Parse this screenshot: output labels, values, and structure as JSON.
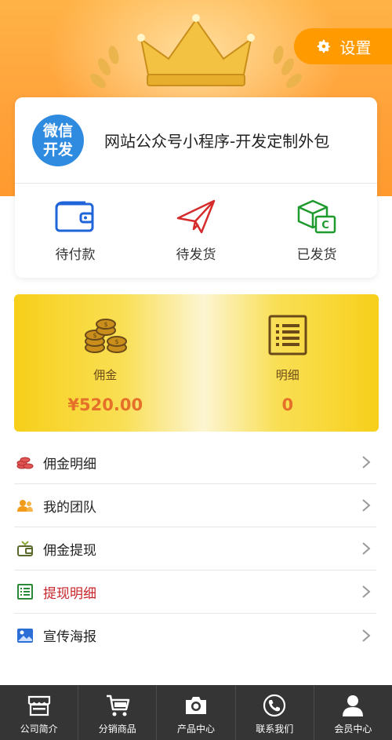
{
  "header": {
    "settings_label": "设置",
    "settings_icon": "gear-icon"
  },
  "profile": {
    "avatar_line1": "微信",
    "avatar_line2": "开发",
    "name": "网站公众号小程序-开发定制外包"
  },
  "orders": [
    {
      "label": "待付款",
      "icon": "wallet-icon"
    },
    {
      "label": "待发货",
      "icon": "paper-plane-icon"
    },
    {
      "label": "已发货",
      "icon": "box-icon"
    }
  ],
  "commission": {
    "left_label": "佣金",
    "left_value": "¥520.00",
    "right_label": "明细",
    "right_value": "0"
  },
  "menu": [
    {
      "label": "佣金明细",
      "icon": "coins-icon"
    },
    {
      "label": "我的团队",
      "icon": "team-icon"
    },
    {
      "label": "佣金提现",
      "icon": "withdraw-icon"
    },
    {
      "label": "提现明细",
      "icon": "list-icon"
    },
    {
      "label": "宣传海报",
      "icon": "image-icon"
    }
  ],
  "tabbar": [
    {
      "label": "公司简介",
      "icon": "store-icon"
    },
    {
      "label": "分销商品",
      "icon": "cart-icon"
    },
    {
      "label": "产品中心",
      "icon": "camera-icon"
    },
    {
      "label": "联系我们",
      "icon": "phone-icon"
    },
    {
      "label": "会员中心",
      "icon": "user-icon"
    }
  ],
  "colors": {
    "header_orange": "#ffa23a",
    "settings_button": "#ff9a00",
    "avatar_blue": "#2f8be0",
    "commission_gold": "#f7cf1a",
    "commission_value": "#e5702a",
    "highlight_red": "#c8262b",
    "tabbar_bg": "#353535"
  }
}
